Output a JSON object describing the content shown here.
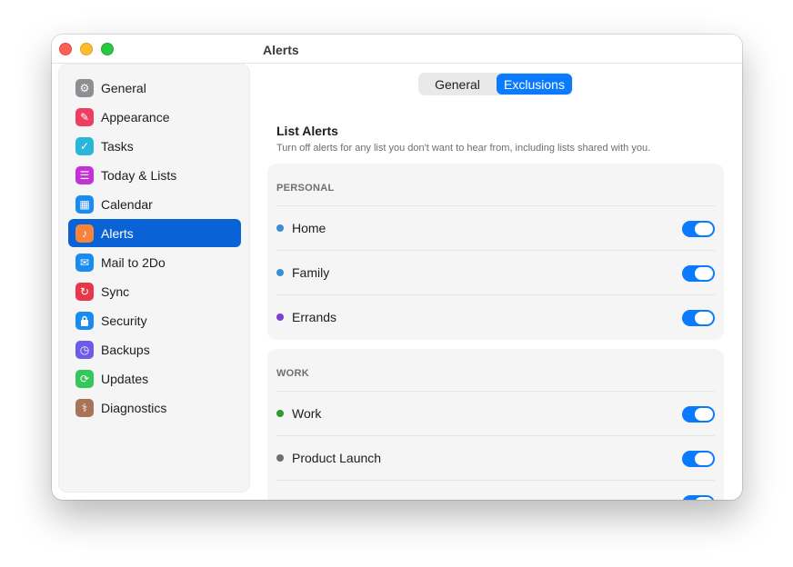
{
  "window": {
    "title": "Alerts"
  },
  "sidebar": {
    "items": [
      {
        "label": "General",
        "icon": "gear-icon",
        "color": "#8e8e93",
        "glyph": "⚙"
      },
      {
        "label": "Appearance",
        "icon": "paintbrush-icon",
        "color": "#ec3f5f",
        "glyph": "✎"
      },
      {
        "label": "Tasks",
        "icon": "checkmark-icon",
        "color": "#29b6d9",
        "glyph": "✓"
      },
      {
        "label": "Today & Lists",
        "icon": "list-icon",
        "color": "#c531d9",
        "glyph": "☰"
      },
      {
        "label": "Calendar",
        "icon": "calendar-icon",
        "color": "#1a8cf0",
        "glyph": "▦"
      },
      {
        "label": "Alerts",
        "icon": "bell-icon",
        "color": "#f7843a",
        "glyph": "♪"
      },
      {
        "label": "Mail to 2Do",
        "icon": "mail-icon",
        "color": "#1a8cf0",
        "glyph": "✉"
      },
      {
        "label": "Sync",
        "icon": "sync-icon",
        "color": "#e8374a",
        "glyph": "↻"
      },
      {
        "label": "Security",
        "icon": "lock-icon",
        "color": "#1a8cf0",
        "glyph": "🔒"
      },
      {
        "label": "Backups",
        "icon": "clock-icon",
        "color": "#6c5ce7",
        "glyph": "◷"
      },
      {
        "label": "Updates",
        "icon": "refresh-icon",
        "color": "#34c759",
        "glyph": "⟳"
      },
      {
        "label": "Diagnostics",
        "icon": "stethoscope-icon",
        "color": "#a87358",
        "glyph": "⚕"
      }
    ],
    "selected": "Alerts"
  },
  "segmented": {
    "general": "General",
    "exclusions": "Exclusions",
    "selected": "Exclusions"
  },
  "section": {
    "title": "List Alerts",
    "subtitle": "Turn off alerts for any list you don't want to hear from, including lists shared with you."
  },
  "groups": [
    {
      "header": "PERSONAL",
      "rows": [
        {
          "label": "Home",
          "color": "#3d8bdb",
          "enabled": true
        },
        {
          "label": "Family",
          "color": "#3d8bdb",
          "enabled": true
        },
        {
          "label": "Errands",
          "color": "#7a3fd1",
          "enabled": true
        }
      ]
    },
    {
      "header": "WORK",
      "rows": [
        {
          "label": "Work",
          "color": "#2f9a2f",
          "enabled": true
        },
        {
          "label": "Product Launch",
          "color": "#6e6e73",
          "enabled": true
        }
      ]
    }
  ]
}
